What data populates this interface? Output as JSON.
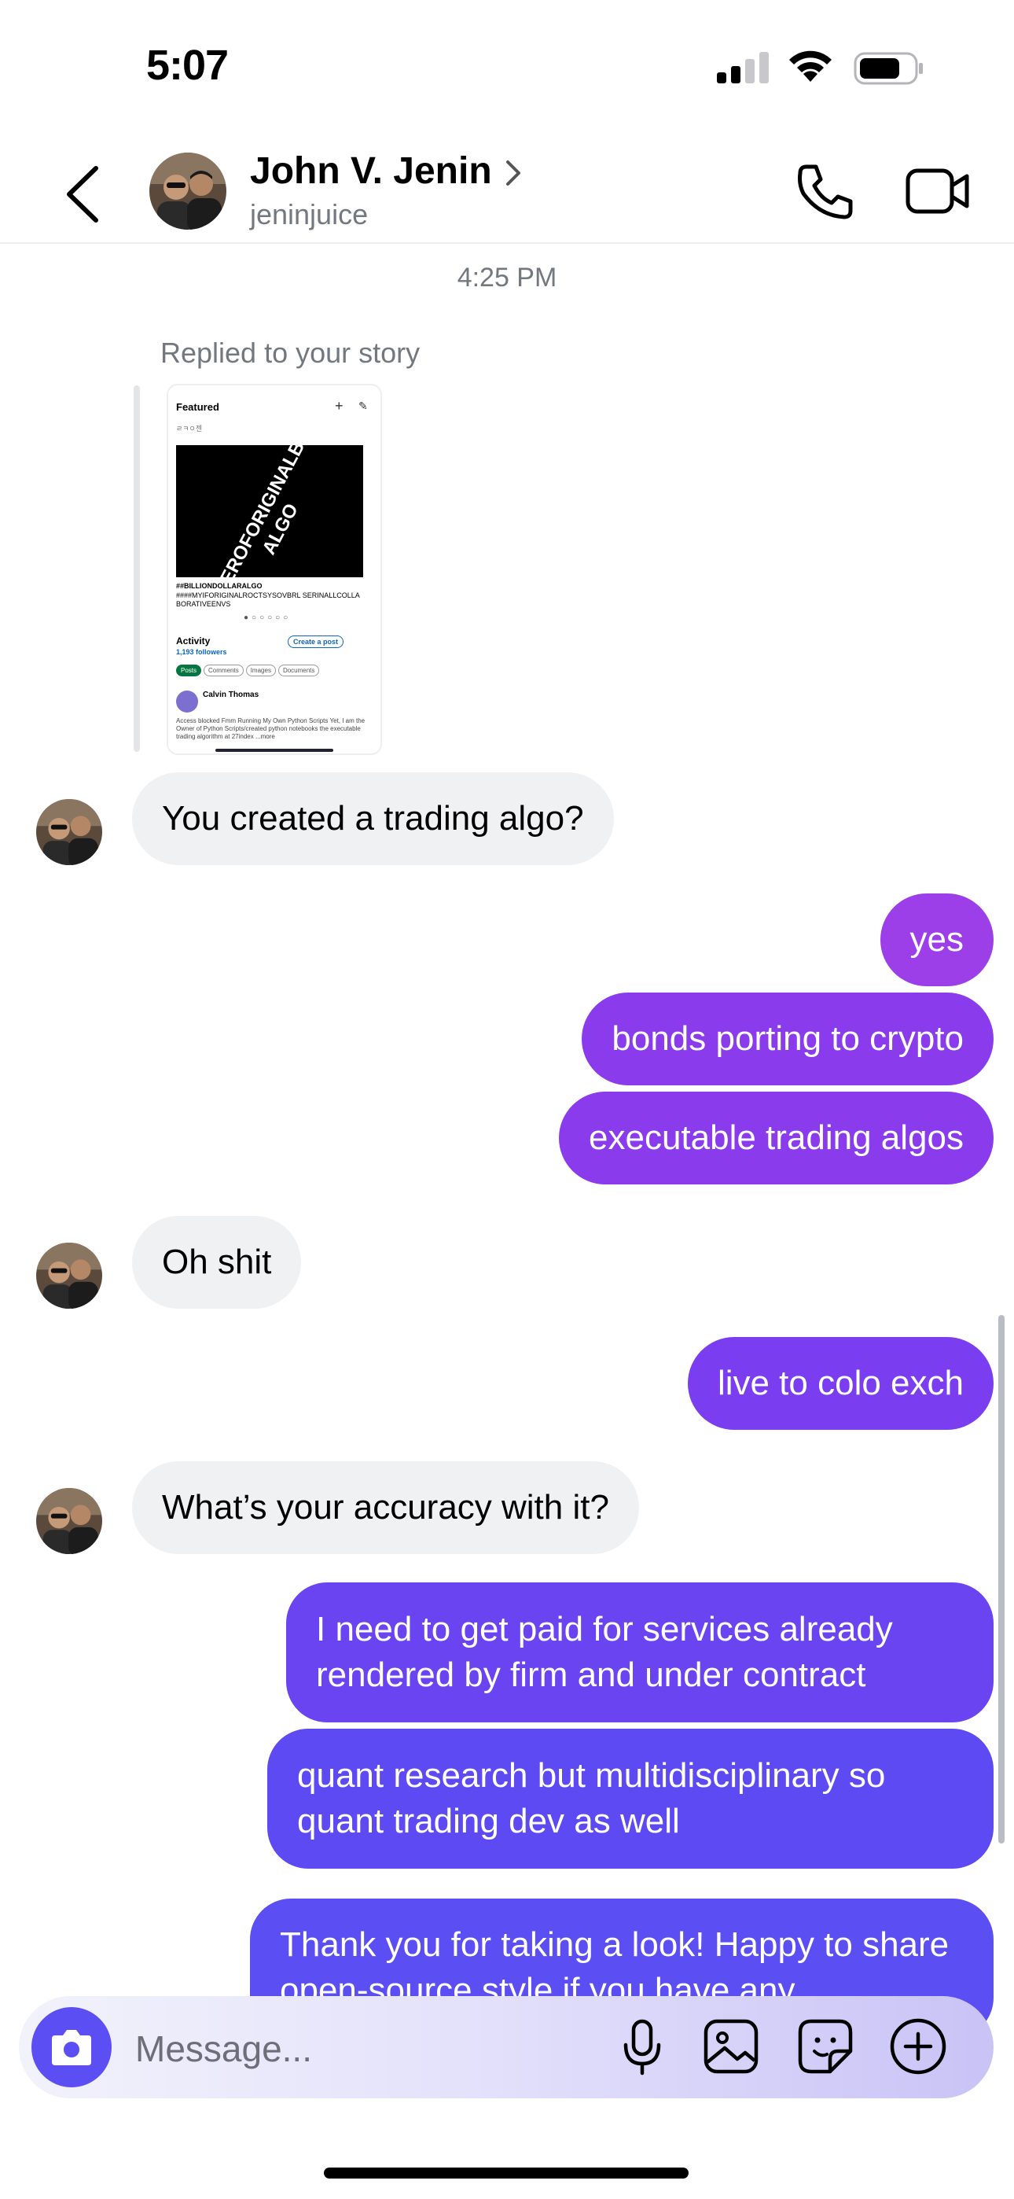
{
  "status_bar": {
    "time": "5:07"
  },
  "header": {
    "contact_name": "John V. Jenin",
    "username": "jeninjuice"
  },
  "thread": {
    "timestamp": "4:25 PM",
    "replied_label": "Replied to your story",
    "story_preview": {
      "featured": "Featured",
      "small_label": "ㄹㅋㅇ젠",
      "image_text": "OWNEROFORIGINALBILLI ALGO",
      "caption_title": "##BILLIONDOLLARALGO",
      "caption_body": "####MYIFORIGINALROCTSYSOVBRL SERINALLCOLLA BORATIVEENVS",
      "dots": "●○○○○○",
      "activity": "Activity",
      "followers": "1,193 followers",
      "create_post": "Create a post",
      "pills": [
        "Posts",
        "Comments",
        "Images",
        "Documents"
      ],
      "author": "Calvin Thomas",
      "body": "Access blocked Fmm Running My Own Python Scripts Yet, I am the Owner of Python Scripts/created python notebooks the executable trading algorithm at 27index ...more"
    },
    "messages": [
      {
        "from": "them",
        "text": "You created a trading algo?"
      },
      {
        "from": "me",
        "text": "yes"
      },
      {
        "from": "me",
        "text": "bonds porting to crypto"
      },
      {
        "from": "me",
        "text": "executable trading algos"
      },
      {
        "from": "them",
        "text": "Oh shit"
      },
      {
        "from": "me",
        "text": "live to colo exch"
      },
      {
        "from": "them",
        "text": "What’s your accuracy with it?"
      },
      {
        "from": "me",
        "text": "I need to get paid for services already rendered by firm and under contract"
      },
      {
        "from": "me",
        "text": "quant research but multidisciplinary so quant trading dev as well"
      },
      {
        "from": "me",
        "text": "Thank you for taking a look! Happy to share open-source style if you have any"
      }
    ]
  },
  "composer": {
    "placeholder": "Message..."
  },
  "colors": {
    "bubble_out_1": "#9c3fe8",
    "bubble_out_2": "#8a3cec",
    "bubble_out_3": "#7a3df0",
    "bubble_out_4": "#6a44f1",
    "bubble_out_5": "#5b4ef2",
    "bubble_in": "#f0f1f3",
    "accent": "#5b4ef2"
  }
}
